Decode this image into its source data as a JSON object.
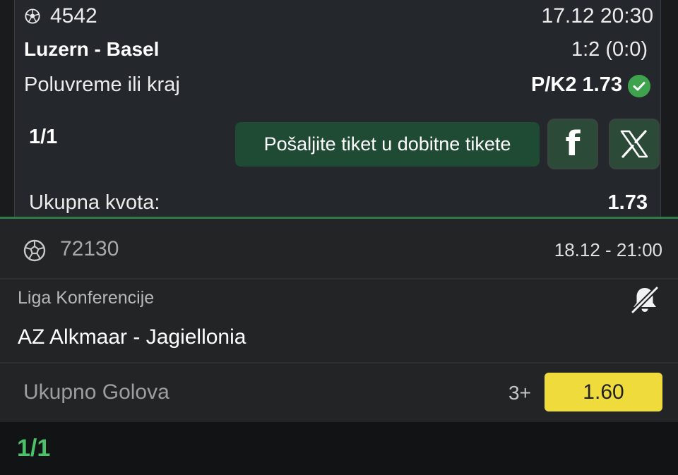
{
  "ticket": {
    "event_id": "4542",
    "datetime": "17.12 20:30",
    "teams": "Luzern - Basel",
    "score": "1:2 (0:0)",
    "market": "Poluvreme ili kraj",
    "pick": "P/K2 1.73",
    "pick_status": "won",
    "count": "1/1",
    "send_button": "Pošaljite tiket u dobitne tikete",
    "total_label": "Ukupna kvota:",
    "total_value": "1.73"
  },
  "sheet": {
    "event_id": "72130",
    "datetime": "18.12  -  21:00",
    "league": "Liga Konferencije",
    "match": "AZ Alkmaar - Jagiellonia",
    "market": "Ukupno Golova",
    "pick": "3+",
    "odd": "1.60",
    "count": "1/1"
  },
  "colors": {
    "accent_green": "#2f7d46",
    "check_green": "#3fa34d",
    "odd_yellow": "#f0db3c",
    "count_green": "#4bc26a"
  },
  "icons": [
    "soccer-ball-icon",
    "check-circle-icon",
    "facebook-icon",
    "x-icon",
    "bell-off-icon"
  ]
}
